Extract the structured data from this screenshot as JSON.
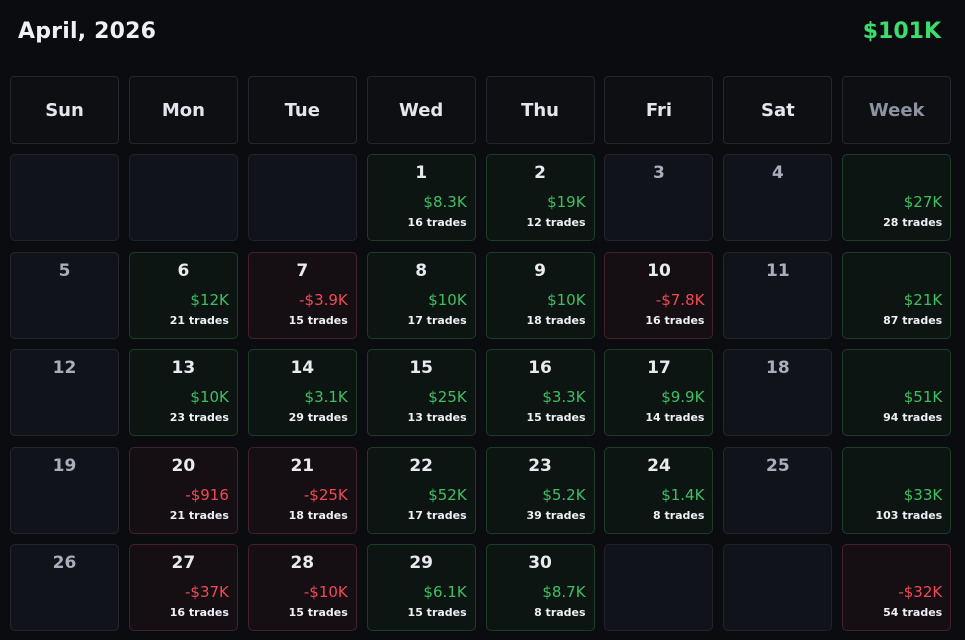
{
  "header": {
    "title": "April, 2026",
    "total": "$101K"
  },
  "days_of_week": [
    "Sun",
    "Mon",
    "Tue",
    "Wed",
    "Thu",
    "Fri",
    "Sat",
    "Week"
  ],
  "weeks": [
    [
      {
        "day": "",
        "pnl": "",
        "trades": "",
        "tone": "empty"
      },
      {
        "day": "",
        "pnl": "",
        "trades": "",
        "tone": "empty"
      },
      {
        "day": "",
        "pnl": "",
        "trades": "",
        "tone": "empty"
      },
      {
        "day": "1",
        "pnl": "$8.3K",
        "trades": "16 trades",
        "tone": "pos"
      },
      {
        "day": "2",
        "pnl": "$19K",
        "trades": "12 trades",
        "tone": "pos"
      },
      {
        "day": "3",
        "pnl": "",
        "trades": "",
        "tone": "neutral"
      },
      {
        "day": "4",
        "pnl": "",
        "trades": "",
        "tone": "neutral"
      },
      {
        "day": "",
        "pnl": "$27K",
        "trades": "28 trades",
        "tone": "pos"
      }
    ],
    [
      {
        "day": "5",
        "pnl": "",
        "trades": "",
        "tone": "neutral"
      },
      {
        "day": "6",
        "pnl": "$12K",
        "trades": "21 trades",
        "tone": "pos"
      },
      {
        "day": "7",
        "pnl": "-$3.9K",
        "trades": "15 trades",
        "tone": "neg"
      },
      {
        "day": "8",
        "pnl": "$10K",
        "trades": "17 trades",
        "tone": "pos"
      },
      {
        "day": "9",
        "pnl": "$10K",
        "trades": "18 trades",
        "tone": "pos"
      },
      {
        "day": "10",
        "pnl": "-$7.8K",
        "trades": "16 trades",
        "tone": "neg"
      },
      {
        "day": "11",
        "pnl": "",
        "trades": "",
        "tone": "neutral"
      },
      {
        "day": "",
        "pnl": "$21K",
        "trades": "87 trades",
        "tone": "pos"
      }
    ],
    [
      {
        "day": "12",
        "pnl": "",
        "trades": "",
        "tone": "neutral"
      },
      {
        "day": "13",
        "pnl": "$10K",
        "trades": "23 trades",
        "tone": "pos"
      },
      {
        "day": "14",
        "pnl": "$3.1K",
        "trades": "29 trades",
        "tone": "pos"
      },
      {
        "day": "15",
        "pnl": "$25K",
        "trades": "13 trades",
        "tone": "pos"
      },
      {
        "day": "16",
        "pnl": "$3.3K",
        "trades": "15 trades",
        "tone": "pos"
      },
      {
        "day": "17",
        "pnl": "$9.9K",
        "trades": "14 trades",
        "tone": "pos"
      },
      {
        "day": "18",
        "pnl": "",
        "trades": "",
        "tone": "neutral"
      },
      {
        "day": "",
        "pnl": "$51K",
        "trades": "94 trades",
        "tone": "pos"
      }
    ],
    [
      {
        "day": "19",
        "pnl": "",
        "trades": "",
        "tone": "neutral"
      },
      {
        "day": "20",
        "pnl": "-$916",
        "trades": "21 trades",
        "tone": "neg"
      },
      {
        "day": "21",
        "pnl": "-$25K",
        "trades": "18 trades",
        "tone": "neg"
      },
      {
        "day": "22",
        "pnl": "$52K",
        "trades": "17 trades",
        "tone": "pos"
      },
      {
        "day": "23",
        "pnl": "$5.2K",
        "trades": "39 trades",
        "tone": "pos"
      },
      {
        "day": "24",
        "pnl": "$1.4K",
        "trades": "8 trades",
        "tone": "pos"
      },
      {
        "day": "25",
        "pnl": "",
        "trades": "",
        "tone": "neutral"
      },
      {
        "day": "",
        "pnl": "$33K",
        "trades": "103 trades",
        "tone": "pos"
      }
    ],
    [
      {
        "day": "26",
        "pnl": "",
        "trades": "",
        "tone": "neutral"
      },
      {
        "day": "27",
        "pnl": "-$37K",
        "trades": "16 trades",
        "tone": "neg"
      },
      {
        "day": "28",
        "pnl": "-$10K",
        "trades": "15 trades",
        "tone": "neg"
      },
      {
        "day": "29",
        "pnl": "$6.1K",
        "trades": "15 trades",
        "tone": "pos"
      },
      {
        "day": "30",
        "pnl": "$8.7K",
        "trades": "8 trades",
        "tone": "pos"
      },
      {
        "day": "",
        "pnl": "",
        "trades": "",
        "tone": "empty"
      },
      {
        "day": "",
        "pnl": "",
        "trades": "",
        "tone": "empty"
      },
      {
        "day": "",
        "pnl": "-$32K",
        "trades": "54 trades",
        "tone": "neg"
      }
    ]
  ],
  "colors": {
    "positive": "#3fbf63",
    "negative": "#ef4a55",
    "total": "#3ddc6e",
    "background": "#0b0c10"
  }
}
